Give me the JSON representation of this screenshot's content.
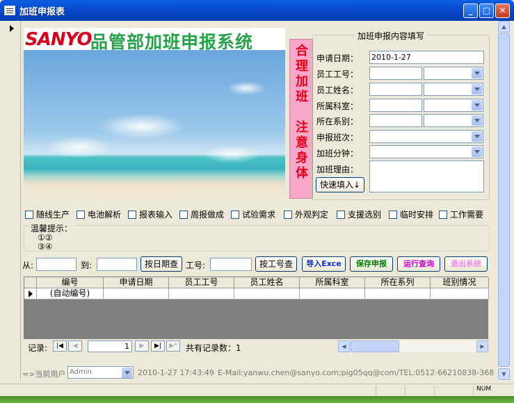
{
  "window": {
    "title": "加班申报表"
  },
  "banner": {
    "logo_text": "SANYO",
    "system_title": "品管部加班申报系统",
    "vertical_text": [
      "合",
      "理",
      "加",
      "班",
      "",
      "注",
      "意",
      "身",
      "体"
    ]
  },
  "form": {
    "legend": "加班申报内容填写",
    "fields": {
      "apply_date": {
        "label": "申请日期：",
        "value": "2010-1-27"
      },
      "employee_id": {
        "label": "员工工号：",
        "value": ""
      },
      "employee_name": {
        "label": "员工姓名：",
        "value": ""
      },
      "department": {
        "label": "所属科室：",
        "value": ""
      },
      "series": {
        "label": "所在系别：",
        "value": ""
      },
      "shift": {
        "label": "申报班次：",
        "value": ""
      },
      "minutes": {
        "label": "加班分钟：",
        "value": ""
      },
      "reason": {
        "label": "加班理由：",
        "value": ""
      }
    },
    "quick_fill": "快速填入↓"
  },
  "reasons": [
    "随线生产",
    "电池解析",
    "报表输入",
    "周报做成",
    "试验需求",
    "外观判定",
    "支援选别",
    "临时安排",
    "工作需要"
  ],
  "tips": {
    "title": "温馨提示：",
    "line1": "①②",
    "line2": "③④"
  },
  "query": {
    "from_label": "从:",
    "to_label": "到:",
    "by_date": "按日期查",
    "emp_label": "工号:",
    "by_emp": "按工号查",
    "export": "导入Exce",
    "save": "保存申报",
    "run_query": "运行查询",
    "exit": "退出系统",
    "colors": {
      "export": "#1030c0",
      "save": "#008000",
      "run_query": "#d000d0",
      "exit": "#f08ce8"
    }
  },
  "table": {
    "columns": [
      "编号",
      "申请日期",
      "员工工号",
      "员工姓名",
      "所属科室",
      "所在系列",
      "班别情况"
    ],
    "new_row_id": "(自动编号)"
  },
  "nav": {
    "label": "记录:",
    "current": "1",
    "total_text": "共有记录数：1"
  },
  "footer": {
    "user_label": "=>当前用户",
    "user": "Admin",
    "datetime": "2010-1-27 17:43:49",
    "contact": "E-Mail:yanwu.chen@sanyo.com;pig05qq@com/TEL:0512-66210838-368"
  },
  "statusbar": {
    "num": "NUM"
  }
}
